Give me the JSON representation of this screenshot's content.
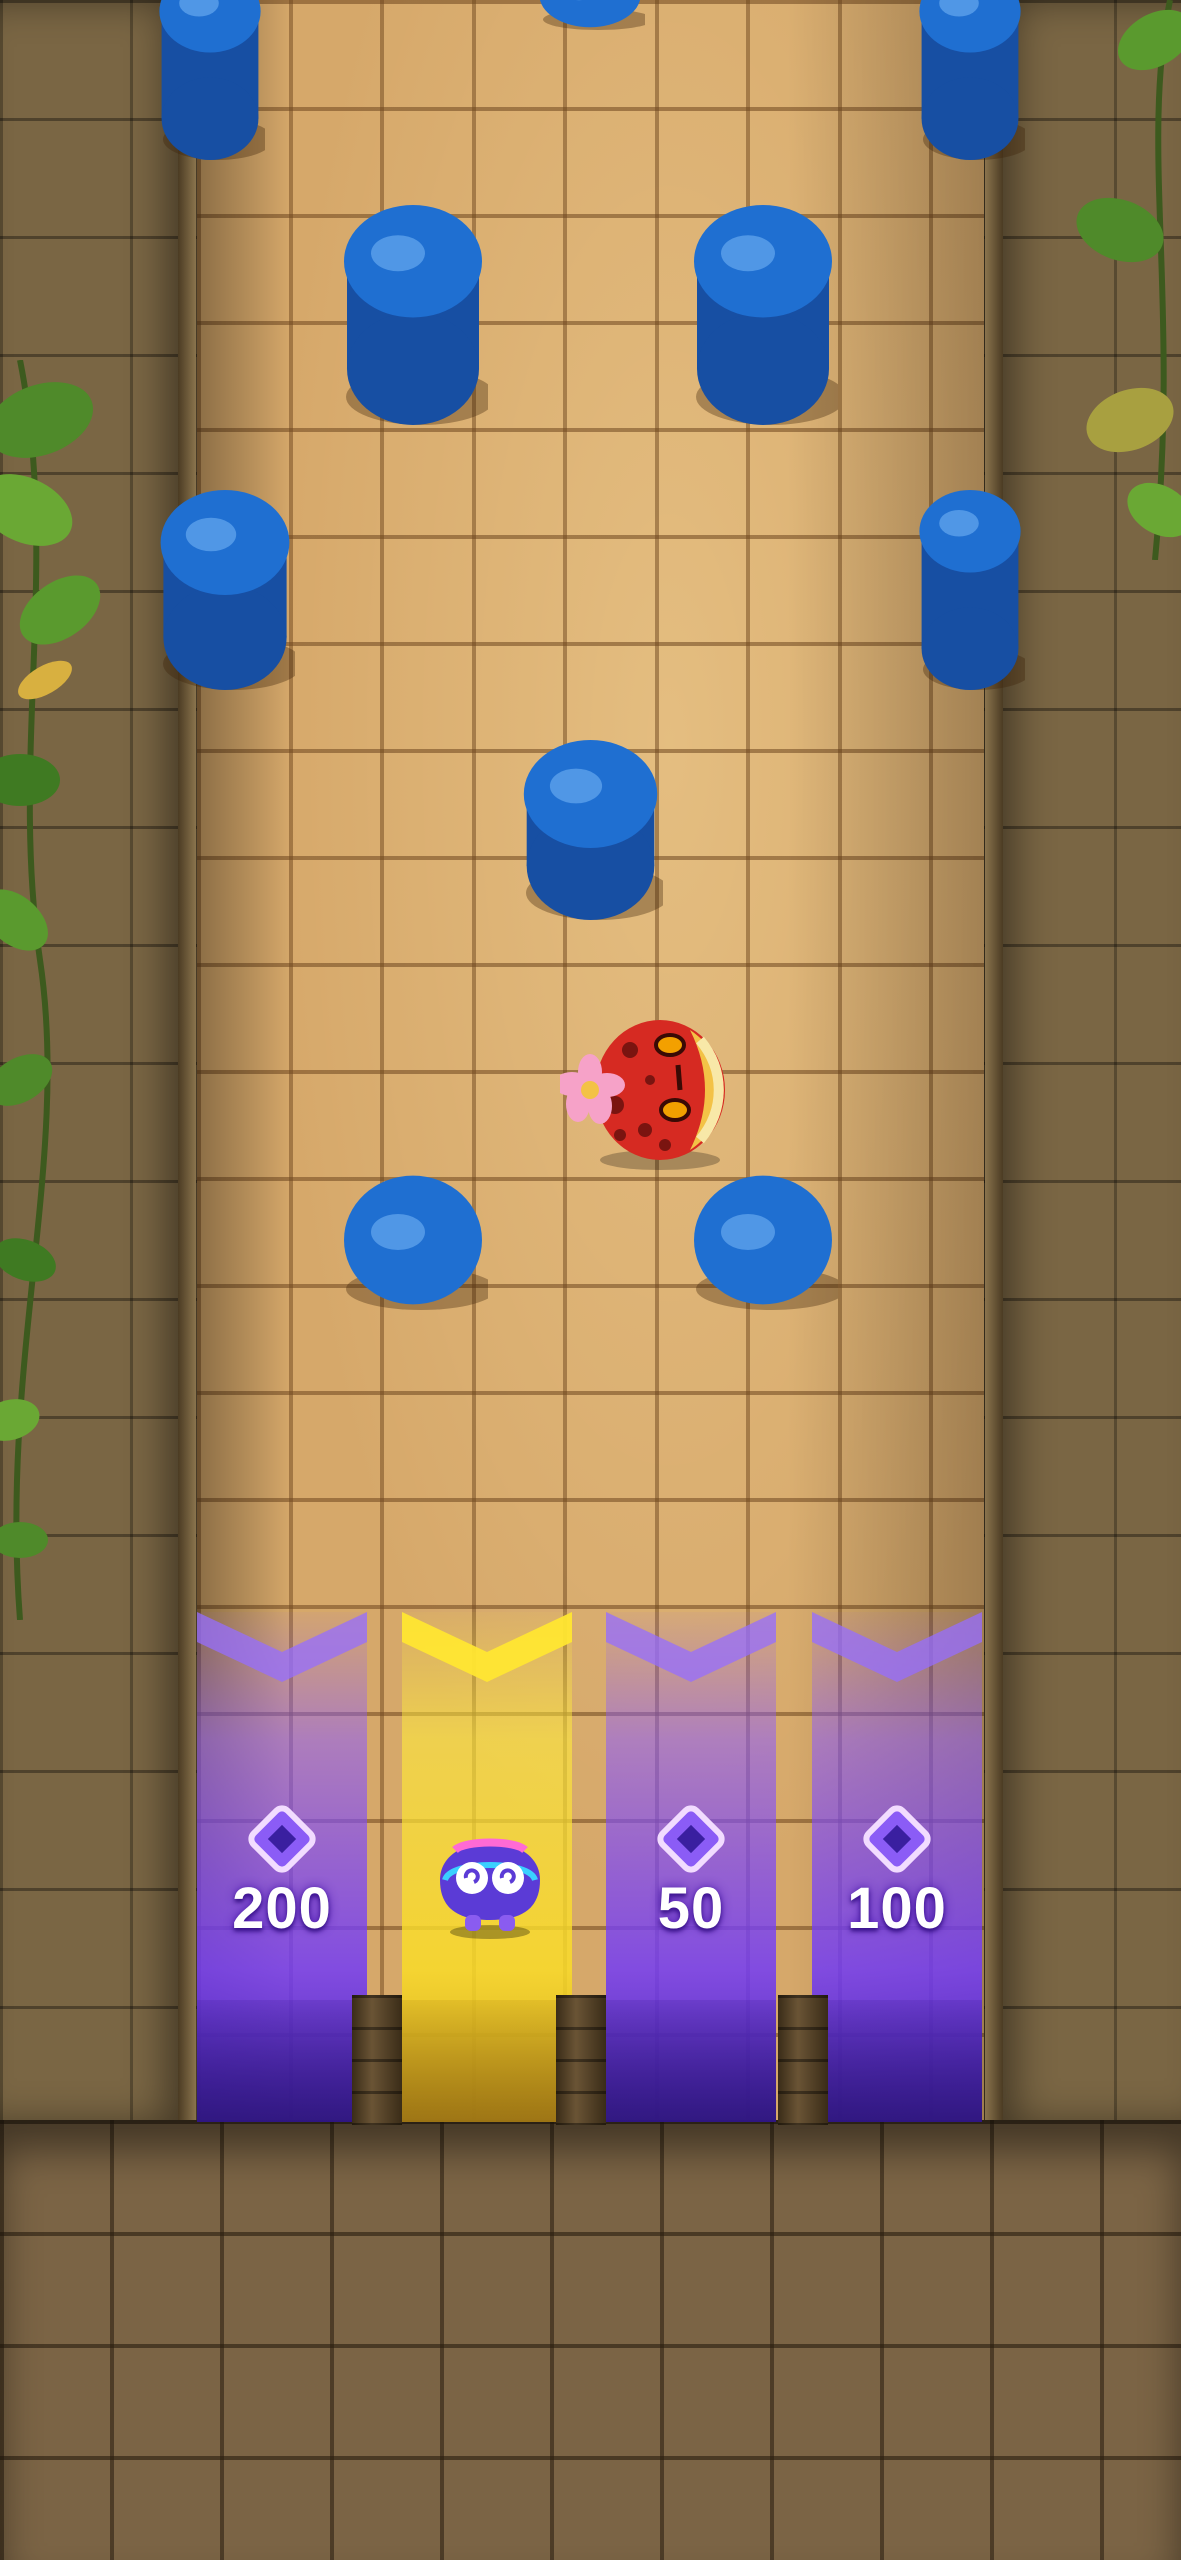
{
  "game": {
    "buckets": [
      {
        "value": "200",
        "highlighted": false,
        "icon": "gem-icon"
      },
      {
        "value": "",
        "highlighted": true,
        "icon": "player-avatar"
      },
      {
        "value": "50",
        "highlighted": false,
        "icon": "gem-icon"
      },
      {
        "value": "100",
        "highlighted": false,
        "icon": "gem-icon"
      }
    ],
    "colors": {
      "peg": "#1f6fd1",
      "bucket": "#7b4cf5",
      "bucket_highlight": "#f6de3a",
      "board": "#d6a86a"
    },
    "ball": {
      "icon": "red-spotted-creature-with-flower"
    }
  }
}
